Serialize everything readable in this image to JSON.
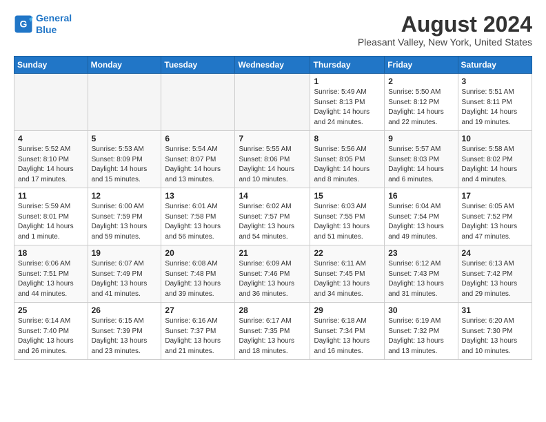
{
  "header": {
    "logo_line1": "General",
    "logo_line2": "Blue",
    "month": "August 2024",
    "location": "Pleasant Valley, New York, United States"
  },
  "days_of_week": [
    "Sunday",
    "Monday",
    "Tuesday",
    "Wednesday",
    "Thursday",
    "Friday",
    "Saturday"
  ],
  "weeks": [
    [
      {
        "num": "",
        "info": ""
      },
      {
        "num": "",
        "info": ""
      },
      {
        "num": "",
        "info": ""
      },
      {
        "num": "",
        "info": ""
      },
      {
        "num": "1",
        "info": "Sunrise: 5:49 AM\nSunset: 8:13 PM\nDaylight: 14 hours\nand 24 minutes."
      },
      {
        "num": "2",
        "info": "Sunrise: 5:50 AM\nSunset: 8:12 PM\nDaylight: 14 hours\nand 22 minutes."
      },
      {
        "num": "3",
        "info": "Sunrise: 5:51 AM\nSunset: 8:11 PM\nDaylight: 14 hours\nand 19 minutes."
      }
    ],
    [
      {
        "num": "4",
        "info": "Sunrise: 5:52 AM\nSunset: 8:10 PM\nDaylight: 14 hours\nand 17 minutes."
      },
      {
        "num": "5",
        "info": "Sunrise: 5:53 AM\nSunset: 8:09 PM\nDaylight: 14 hours\nand 15 minutes."
      },
      {
        "num": "6",
        "info": "Sunrise: 5:54 AM\nSunset: 8:07 PM\nDaylight: 14 hours\nand 13 minutes."
      },
      {
        "num": "7",
        "info": "Sunrise: 5:55 AM\nSunset: 8:06 PM\nDaylight: 14 hours\nand 10 minutes."
      },
      {
        "num": "8",
        "info": "Sunrise: 5:56 AM\nSunset: 8:05 PM\nDaylight: 14 hours\nand 8 minutes."
      },
      {
        "num": "9",
        "info": "Sunrise: 5:57 AM\nSunset: 8:03 PM\nDaylight: 14 hours\nand 6 minutes."
      },
      {
        "num": "10",
        "info": "Sunrise: 5:58 AM\nSunset: 8:02 PM\nDaylight: 14 hours\nand 4 minutes."
      }
    ],
    [
      {
        "num": "11",
        "info": "Sunrise: 5:59 AM\nSunset: 8:01 PM\nDaylight: 14 hours\nand 1 minute."
      },
      {
        "num": "12",
        "info": "Sunrise: 6:00 AM\nSunset: 7:59 PM\nDaylight: 13 hours\nand 59 minutes."
      },
      {
        "num": "13",
        "info": "Sunrise: 6:01 AM\nSunset: 7:58 PM\nDaylight: 13 hours\nand 56 minutes."
      },
      {
        "num": "14",
        "info": "Sunrise: 6:02 AM\nSunset: 7:57 PM\nDaylight: 13 hours\nand 54 minutes."
      },
      {
        "num": "15",
        "info": "Sunrise: 6:03 AM\nSunset: 7:55 PM\nDaylight: 13 hours\nand 51 minutes."
      },
      {
        "num": "16",
        "info": "Sunrise: 6:04 AM\nSunset: 7:54 PM\nDaylight: 13 hours\nand 49 minutes."
      },
      {
        "num": "17",
        "info": "Sunrise: 6:05 AM\nSunset: 7:52 PM\nDaylight: 13 hours\nand 47 minutes."
      }
    ],
    [
      {
        "num": "18",
        "info": "Sunrise: 6:06 AM\nSunset: 7:51 PM\nDaylight: 13 hours\nand 44 minutes."
      },
      {
        "num": "19",
        "info": "Sunrise: 6:07 AM\nSunset: 7:49 PM\nDaylight: 13 hours\nand 41 minutes."
      },
      {
        "num": "20",
        "info": "Sunrise: 6:08 AM\nSunset: 7:48 PM\nDaylight: 13 hours\nand 39 minutes."
      },
      {
        "num": "21",
        "info": "Sunrise: 6:09 AM\nSunset: 7:46 PM\nDaylight: 13 hours\nand 36 minutes."
      },
      {
        "num": "22",
        "info": "Sunrise: 6:11 AM\nSunset: 7:45 PM\nDaylight: 13 hours\nand 34 minutes."
      },
      {
        "num": "23",
        "info": "Sunrise: 6:12 AM\nSunset: 7:43 PM\nDaylight: 13 hours\nand 31 minutes."
      },
      {
        "num": "24",
        "info": "Sunrise: 6:13 AM\nSunset: 7:42 PM\nDaylight: 13 hours\nand 29 minutes."
      }
    ],
    [
      {
        "num": "25",
        "info": "Sunrise: 6:14 AM\nSunset: 7:40 PM\nDaylight: 13 hours\nand 26 minutes."
      },
      {
        "num": "26",
        "info": "Sunrise: 6:15 AM\nSunset: 7:39 PM\nDaylight: 13 hours\nand 23 minutes."
      },
      {
        "num": "27",
        "info": "Sunrise: 6:16 AM\nSunset: 7:37 PM\nDaylight: 13 hours\nand 21 minutes."
      },
      {
        "num": "28",
        "info": "Sunrise: 6:17 AM\nSunset: 7:35 PM\nDaylight: 13 hours\nand 18 minutes."
      },
      {
        "num": "29",
        "info": "Sunrise: 6:18 AM\nSunset: 7:34 PM\nDaylight: 13 hours\nand 16 minutes."
      },
      {
        "num": "30",
        "info": "Sunrise: 6:19 AM\nSunset: 7:32 PM\nDaylight: 13 hours\nand 13 minutes."
      },
      {
        "num": "31",
        "info": "Sunrise: 6:20 AM\nSunset: 7:30 PM\nDaylight: 13 hours\nand 10 minutes."
      }
    ]
  ]
}
